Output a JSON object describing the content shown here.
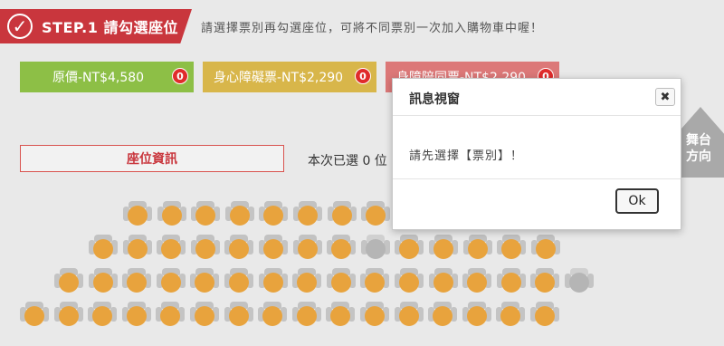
{
  "step": {
    "check_icon": "check-circle-icon",
    "title": "STEP.1 請勾選座位",
    "hint": "請選擇票別再勾選座位，可將不同票別一次加入購物車中喔！"
  },
  "tickets": [
    {
      "label": "原價-NT$4,580",
      "count": "0",
      "color": "#8dbf46"
    },
    {
      "label": "身心障礙票-NT$2,290",
      "count": "0",
      "color": "#d8b64a"
    },
    {
      "label": "身障陪同票-NT$2,290",
      "count": "0",
      "color": "#dc7878"
    }
  ],
  "seat_info": {
    "label": "座位資訊",
    "selected_text": "本次已選 0 位"
  },
  "stage": {
    "text": "舞台方向",
    "icon": "arrow-up-icon"
  },
  "seating": {
    "available_color": "#e8a33d",
    "sold_color": "#b5b5b5",
    "rows": [
      {
        "seats": [
          "a",
          "a",
          "a",
          "a",
          "a",
          "a",
          "a",
          "a",
          "a"
        ]
      },
      {
        "seats": [
          "a",
          "a",
          "a",
          "a",
          "a",
          "a",
          "a",
          "a",
          "s",
          "a",
          "a",
          "a",
          "a",
          "a"
        ]
      },
      {
        "seats": [
          "a",
          "a",
          "a",
          "a",
          "a",
          "a",
          "a",
          "a",
          "a",
          "a",
          "a",
          "a",
          "a",
          "a",
          "a",
          "s"
        ]
      },
      {
        "seats": [
          "a",
          "a",
          "a",
          "a",
          "a",
          "a",
          "a",
          "a",
          "a",
          "a",
          "a",
          "a",
          "a",
          "a",
          "a",
          "a"
        ]
      }
    ]
  },
  "modal": {
    "title": "訊息視窗",
    "close_label": "✖",
    "message": "請先選擇【票別】！",
    "ok_label": "Ok"
  }
}
